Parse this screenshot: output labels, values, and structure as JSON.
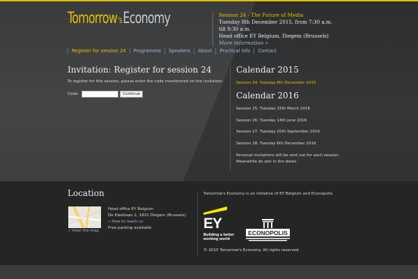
{
  "colors": {
    "accent": "#e6c200",
    "link": "#9fb8d6",
    "background": "#3a3b3c",
    "footer": "#252526"
  },
  "logo": {
    "part1": "Tomorrow",
    "part2": "'s",
    "part3": "Economy"
  },
  "header": {
    "session_title": "Session 24 - The Future of Media",
    "session_date": "Tuesday 8th December 2015, from 7:30 a.m. till 9:30 a.m.",
    "session_place": "Head office EY Belgium, Diegem (Brussels)",
    "more_link": "More information »"
  },
  "nav": [
    "Register for session 24",
    "Programme",
    "Speakers",
    "About",
    "Practical info",
    "Contact"
  ],
  "main": {
    "title": "Invitation: Register for session 24",
    "instruction": "To register for this session, please enter the code mentionned on the invitation:",
    "code_label": "Code:",
    "code_value": "",
    "submit_label": "Continue"
  },
  "calendar": {
    "title_2015": "Calendar 2015",
    "items_2015": [
      "Session 24: Tuesday 8th December 2015"
    ],
    "title_2016": "Calendar 2016",
    "items_2016": [
      "Session 25: Tuesday 15th March 2016",
      "Session 26: Tuesday 14th June 2016",
      "Session 27: Tuesday 20th September 2016",
      "Session 28: Tuesday 6th December 2016"
    ],
    "note_line1": "Personal invitations will be sent out for each session.",
    "note_line2": "Meanwhile do pen in the dates."
  },
  "footer": {
    "location_title": "Location",
    "view_map": "» View the map",
    "address_name": "Head office EY Belgium",
    "address_street": "De Kleetlaan 2, 1831 Diegem (Brussels)",
    "how_to_reach": "» How to reach us",
    "parking": "Free parking available",
    "initiative": "Tomorrow's Economy is an initiative of EY Belgium and Econopolis.",
    "ey_letters": "EY",
    "ey_tagline_line1": "Building a better",
    "ey_tagline_line2": "working world",
    "econopolis": "ECONOPOLIS",
    "copyright": "© 2015 Tomorrow's Economy. All rights reserved."
  }
}
